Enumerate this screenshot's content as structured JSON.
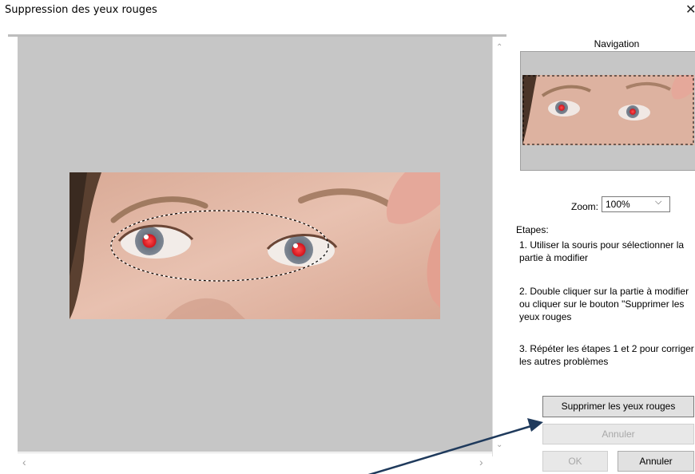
{
  "window": {
    "title": "Suppression des yeux rouges"
  },
  "navigation": {
    "title": "Navigation"
  },
  "zoom": {
    "label": "Zoom:",
    "value": "100%"
  },
  "steps": {
    "heading": "Etapes:",
    "items": [
      "1. Utiliser la souris pour sélectionner la partie à modifier",
      "2. Double cliquer sur la partie à modifier ou cliquer sur le bouton \"Supprimer les yeux rouges",
      "3. Répéter les étapes 1 et 2 pour corriger les autres problèmes"
    ]
  },
  "buttons": {
    "remove_red_eye": "Supprimer les yeux rouges",
    "cancel_action": "Annuler",
    "ok": "OK",
    "cancel": "Annuler"
  },
  "icons": {
    "close": "close-icon",
    "scroll_up": "chevron-up-icon",
    "scroll_down": "chevron-down-icon",
    "scroll_left": "chevron-left-icon",
    "scroll_right": "chevron-right-icon"
  },
  "colors": {
    "canvas_bg": "#c6c6c6",
    "annotation_arrow": "#1f3a5c",
    "pupil": "#e0202a"
  }
}
